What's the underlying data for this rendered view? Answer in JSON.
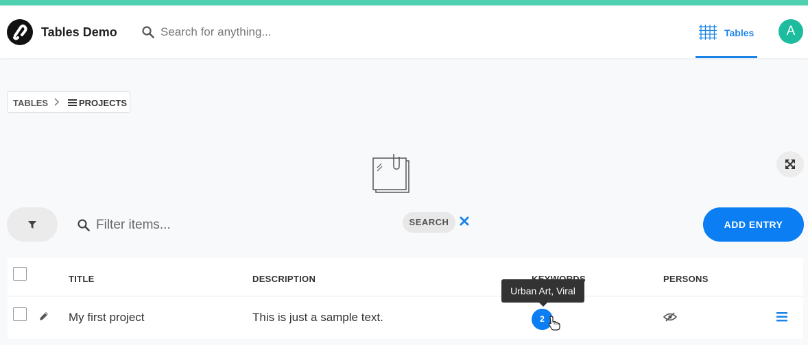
{
  "header": {
    "app_title": "Tables Demo",
    "search_placeholder": "Search for anything...",
    "nav_tab_label": "Tables",
    "avatar_initial": "A",
    "accent_color": "#4fd1b0",
    "brand_blue": "#1b84e8"
  },
  "breadcrumb": {
    "root": "TABLES",
    "current": "PROJECTS"
  },
  "toolbar": {
    "filter_placeholder": "Filter items...",
    "search_chip": "SEARCH",
    "add_button": "ADD ENTRY"
  },
  "table": {
    "columns": [
      "TITLE",
      "DESCRIPTION",
      "KEYWORDS",
      "PERSONS"
    ],
    "rows": [
      {
        "title": "My first project",
        "description": "This is just a sample text.",
        "keyword_count": "2"
      }
    ]
  },
  "tooltip": {
    "text": "Urban Art, Viral"
  },
  "icons": [
    "logo-icon",
    "search-icon",
    "grid-icon",
    "chevron-right-icon",
    "list-icon",
    "sticky-note-icon",
    "expand-icon",
    "filter-icon",
    "close-icon",
    "pencil-icon",
    "eye-off-icon",
    "menu-icon",
    "hand-cursor-icon"
  ]
}
